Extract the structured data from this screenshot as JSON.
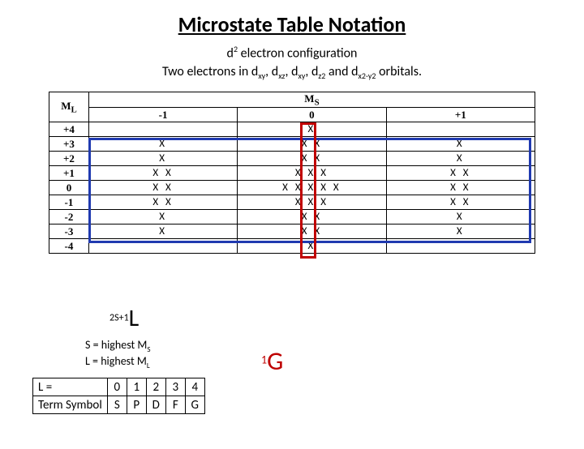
{
  "title": "Microstate Table Notation",
  "subtitle_html": "d<sup>2</sup> electron configuration",
  "desc_html": "Two electrons in d<sub>xy</sub>, d<sub>xz</sub>, d<sub>xy</sub>, d<sub>z2</sub> and d<sub>x2-y2</sub> orbitals.",
  "table": {
    "col_header_label": "M",
    "col_header_sub": "S",
    "row_header_label": "M",
    "row_header_sub": "L",
    "ms_values": [
      "-1",
      "0",
      "+1"
    ],
    "ml_values": [
      "+4",
      "+3",
      "+2",
      "+1",
      "0",
      "-1",
      "-2",
      "-3",
      "-4"
    ],
    "cells": {
      "r0": [
        "",
        "X",
        ""
      ],
      "r1": [
        "X",
        "X X",
        "X"
      ],
      "r2": [
        "X",
        "X X",
        "X"
      ],
      "r3": [
        "X X",
        "X X X",
        "X X"
      ],
      "r4": [
        "X X",
        "X X X X X",
        "X X"
      ],
      "r5": [
        "X X",
        "X X X",
        "X X"
      ],
      "r6": [
        "X",
        "X X",
        "X"
      ],
      "r7": [
        "X",
        "X X",
        "X"
      ],
      "r8": [
        "",
        "X",
        ""
      ]
    }
  },
  "term_formula_html": "<sup>2S+1</sup><span class=\"big\">L</span>",
  "legend": {
    "line1_html": "S = highest M<sub>S</sub>",
    "line2_html": "L = highest M<sub>L</sub>"
  },
  "ground_html": "<sup>1</sup><span class=\"gbig\">G</span>",
  "lookup": {
    "row1_label": "L =",
    "row1": [
      "0",
      "1",
      "2",
      "3",
      "4"
    ],
    "row2_label": "Term Symbol",
    "row2": [
      "S",
      "P",
      "D",
      "F",
      "G"
    ]
  }
}
